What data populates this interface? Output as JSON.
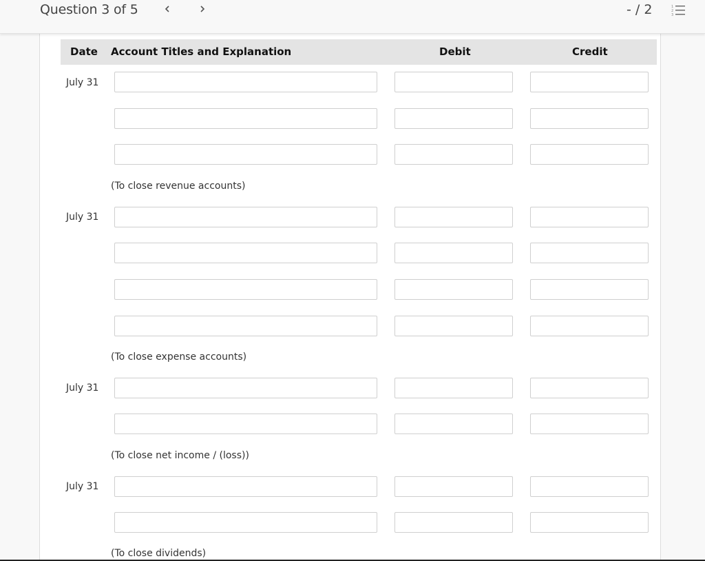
{
  "header": {
    "question_label": "Question 3 of 5",
    "prev_icon": "‹",
    "next_icon": "›",
    "score": "- / 2",
    "list_icon": "numbered-list-icon"
  },
  "table": {
    "columns": {
      "date": "Date",
      "account": "Account Titles and Explanation",
      "debit": "Debit",
      "credit": "Credit"
    },
    "entries": [
      {
        "date": "July 31",
        "rows": 3,
        "note": "(To close revenue accounts)"
      },
      {
        "date": "July 31",
        "rows": 4,
        "note": "(To close expense accounts)"
      },
      {
        "date": "July 31",
        "rows": 2,
        "note": "(To close net income / (loss))"
      },
      {
        "date": "July 31",
        "rows": 2,
        "note": "(To close dividends)"
      }
    ],
    "input_values": {
      "account": "",
      "debit": "",
      "credit": ""
    }
  }
}
